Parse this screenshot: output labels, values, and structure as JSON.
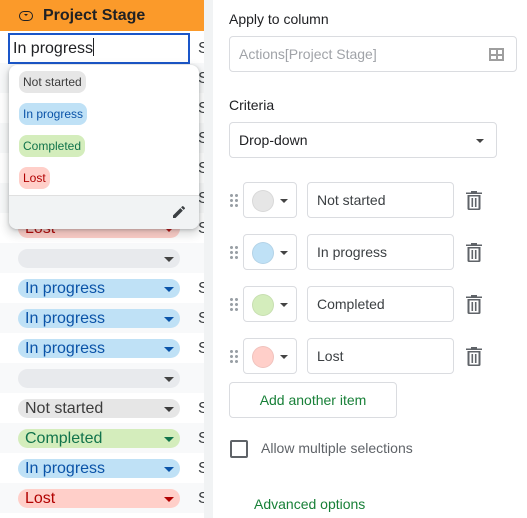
{
  "sheet": {
    "column_header": "Project Stage",
    "editing_cell_value": "In progress",
    "next_column_char": "S",
    "rows": [
      {
        "value": "Lost",
        "style": "lost",
        "next": "S"
      },
      {
        "value": "",
        "style": "empty",
        "next": ""
      },
      {
        "value": "In progress",
        "style": "inprogress",
        "next": "S"
      },
      {
        "value": "In progress",
        "style": "inprogress",
        "next": "S"
      },
      {
        "value": "In progress",
        "style": "inprogress",
        "next": "S"
      },
      {
        "value": "",
        "style": "empty",
        "next": ""
      },
      {
        "value": "Not started",
        "style": "notstarted",
        "next": "S"
      },
      {
        "value": "Completed",
        "style": "completed",
        "next": "S"
      },
      {
        "value": "In progress",
        "style": "inprogress",
        "next": "S"
      },
      {
        "value": "Lost",
        "style": "lost",
        "next": "S"
      }
    ],
    "dropdown_options": [
      {
        "label": "Not started",
        "style": "notstarted"
      },
      {
        "label": "In progress",
        "style": "inprogress"
      },
      {
        "label": "Completed",
        "style": "completed"
      },
      {
        "label": "Lost",
        "style": "lost"
      }
    ],
    "edit_icon": "pencil-icon"
  },
  "panel": {
    "apply_label": "Apply to column",
    "apply_value": "Actions[Project Stage]",
    "apply_icon": "grid-icon",
    "criteria_label": "Criteria",
    "criteria_value": "Drop-down",
    "items": [
      {
        "label": "Not started",
        "color": "#e6e6e6"
      },
      {
        "label": "In progress",
        "color": "#bfe1f6"
      },
      {
        "label": "Completed",
        "color": "#d4edbc"
      },
      {
        "label": "Lost",
        "color": "#ffcfc9"
      }
    ],
    "add_button": "Add another item",
    "allow_multiple_label": "Allow multiple selections",
    "allow_multiple_checked": false,
    "advanced_options": "Advanced options"
  },
  "colors": {
    "header_bg": "#fb9a2a",
    "accent_green": "#188038",
    "selection_blue": "#1a56c9"
  }
}
